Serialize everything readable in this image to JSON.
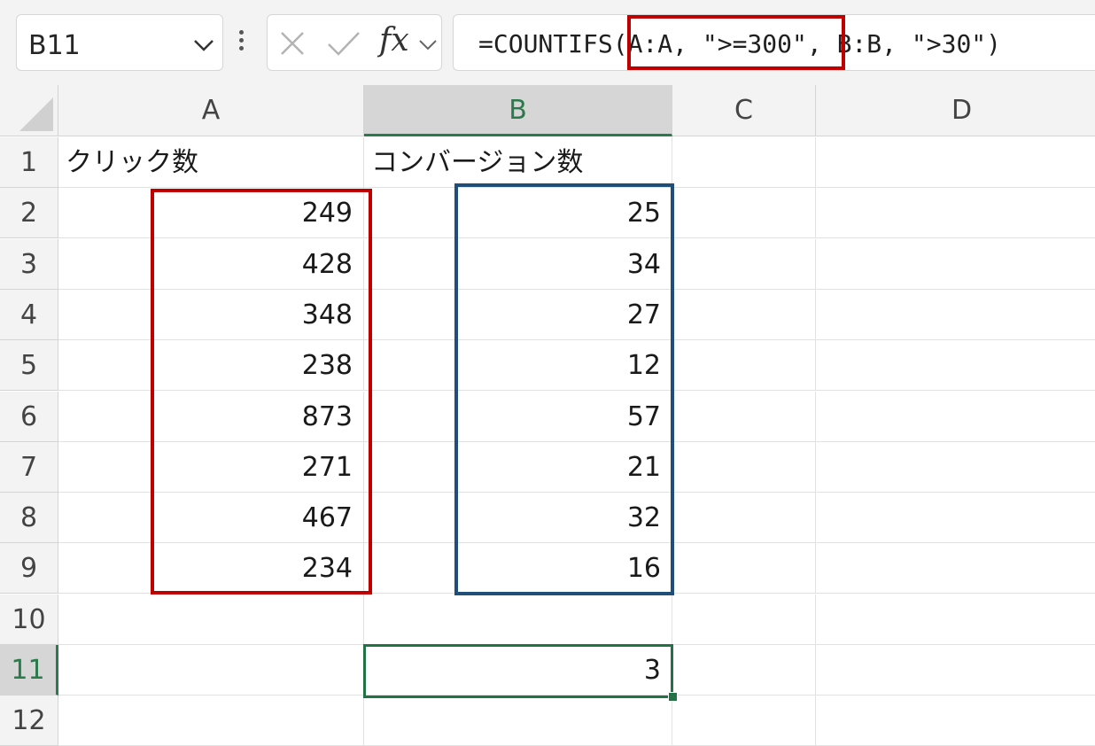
{
  "namebox": {
    "value": "B11"
  },
  "formula_bar": {
    "fx_label": "fx",
    "formula": "=COUNTIFS(A:A, \">=300\", B:B, \">30\")"
  },
  "columns": [
    "A",
    "B",
    "C",
    "D"
  ],
  "rows": [
    {
      "num": "1",
      "A": "クリック数",
      "B": "コンバージョン数"
    },
    {
      "num": "2",
      "A": "249",
      "B": "25"
    },
    {
      "num": "3",
      "A": "428",
      "B": "34"
    },
    {
      "num": "4",
      "A": "348",
      "B": "27"
    },
    {
      "num": "5",
      "A": "238",
      "B": "12"
    },
    {
      "num": "6",
      "A": "873",
      "B": "57"
    },
    {
      "num": "7",
      "A": "271",
      "B": "21"
    },
    {
      "num": "8",
      "A": "467",
      "B": "32"
    },
    {
      "num": "9",
      "A": "234",
      "B": "16"
    },
    {
      "num": "10",
      "A": "",
      "B": ""
    },
    {
      "num": "11",
      "A": "",
      "B": "3"
    },
    {
      "num": "12",
      "A": "",
      "B": ""
    }
  ],
  "selection": {
    "column": "B",
    "row": "11"
  },
  "colors": {
    "criteria_range_1": "#c00000",
    "criteria_range_2": "#1f4e79",
    "active_cell": "#217346"
  },
  "icons": [
    "chevron-down-icon",
    "more-vertical-icon",
    "cancel-icon",
    "enter-icon",
    "fx-icon"
  ]
}
